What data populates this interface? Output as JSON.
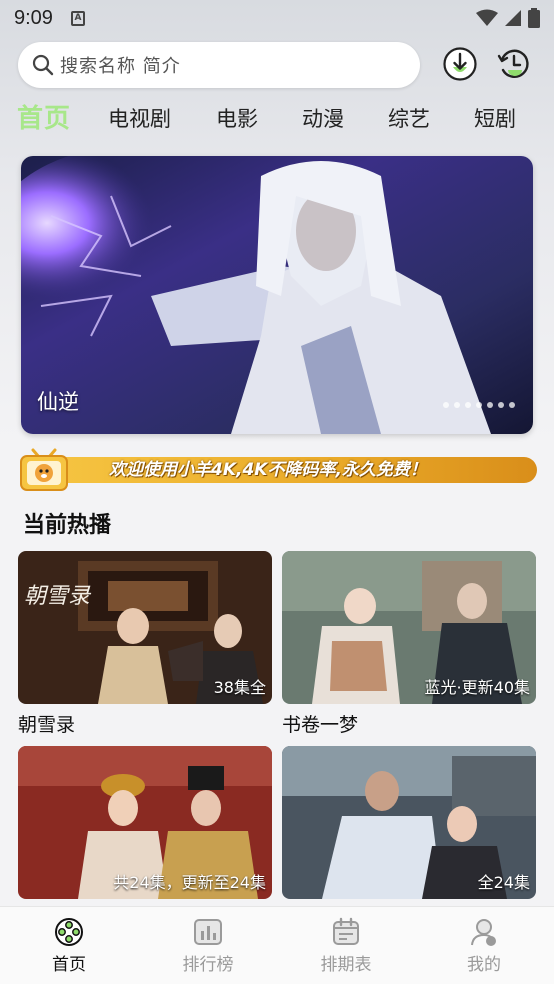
{
  "status_bar": {
    "time": "9:09",
    "notification_letter": "A"
  },
  "search": {
    "placeholder": "搜索名称 简介"
  },
  "tabs": [
    {
      "label": "首页",
      "active": true
    },
    {
      "label": "电视剧"
    },
    {
      "label": "电影"
    },
    {
      "label": "动漫"
    },
    {
      "label": "综艺"
    },
    {
      "label": "短剧"
    }
  ],
  "banner": {
    "title": "仙逆",
    "page_count": 7
  },
  "notice": {
    "text": "欢迎使用小羊4K,4K不降码率,永久免费！"
  },
  "section": {
    "title": "当前热播"
  },
  "cards": [
    {
      "title": "朝雪录",
      "badge": "38集全",
      "overlay_text": "朝雪录"
    },
    {
      "title": "书卷一梦",
      "badge": "蓝光·更新40集"
    },
    {
      "title": "",
      "badge": "共24集，更新至24集"
    },
    {
      "title": "",
      "badge": "全24集"
    }
  ],
  "bottom_nav": [
    {
      "label": "首页",
      "icon": "film-reel-icon",
      "active": true
    },
    {
      "label": "排行榜",
      "icon": "chart-icon"
    },
    {
      "label": "排期表",
      "icon": "calendar-icon"
    },
    {
      "label": "我的",
      "icon": "profile-icon"
    }
  ],
  "colors": {
    "accent": "#a8e78a",
    "notice": "#e9a928"
  }
}
